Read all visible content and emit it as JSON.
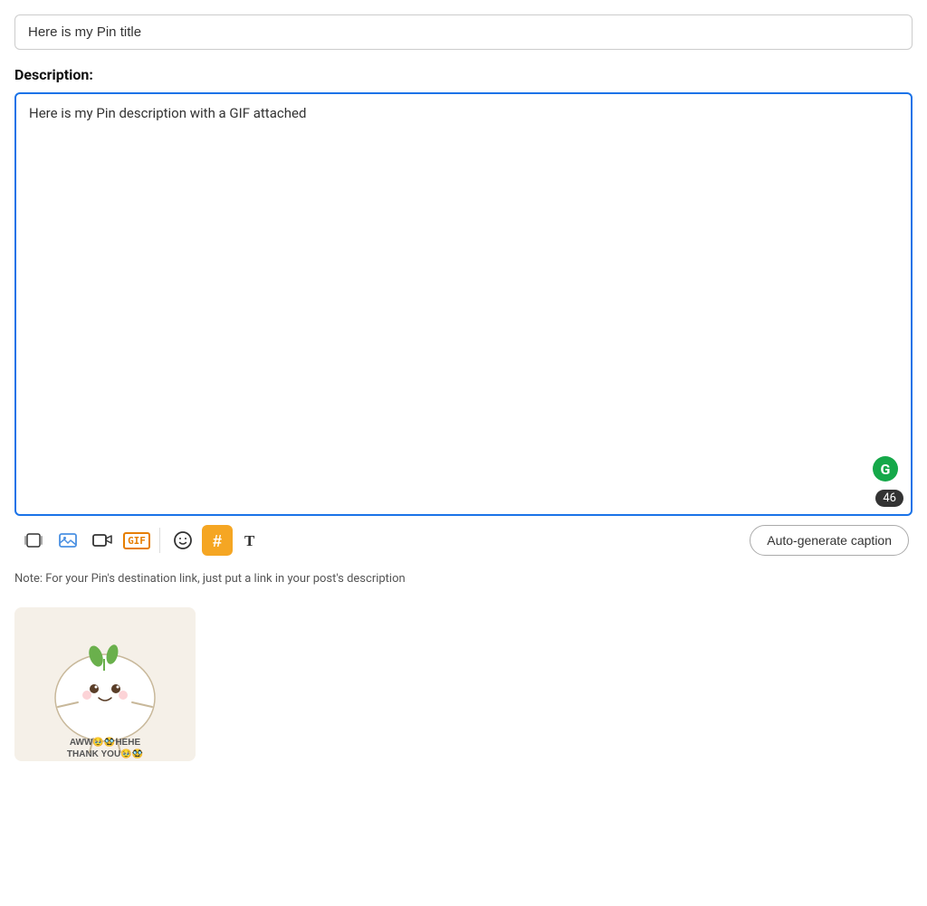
{
  "title_input": {
    "value": "Here is my Pin title",
    "placeholder": "Here is my Pin title"
  },
  "description": {
    "label": "Description:",
    "value": "Here is my Pin description with a GIF attached",
    "char_count": "46"
  },
  "toolbar": {
    "icons": [
      {
        "name": "carousel-icon",
        "symbol": "⊞",
        "label": "Carousel"
      },
      {
        "name": "image-icon",
        "symbol": "🖼",
        "label": "Image"
      },
      {
        "name": "video-icon",
        "symbol": "🎬",
        "label": "Video"
      },
      {
        "name": "gif-icon",
        "label": "GIF"
      },
      {
        "name": "emoji-icon",
        "symbol": "😊",
        "label": "Emoji"
      },
      {
        "name": "hashtag-icon",
        "symbol": "#",
        "label": "Hashtag"
      },
      {
        "name": "text-icon",
        "symbol": "T",
        "label": "Text"
      }
    ],
    "auto_generate_label": "Auto-generate caption"
  },
  "note": {
    "text": "Note: For your Pin's destination link, just put a link in your post's description"
  },
  "gif_attachment": {
    "caption_line1": "AWW🥹🥸HEHE",
    "caption_line2": "THANK YOU🥹🥸"
  }
}
